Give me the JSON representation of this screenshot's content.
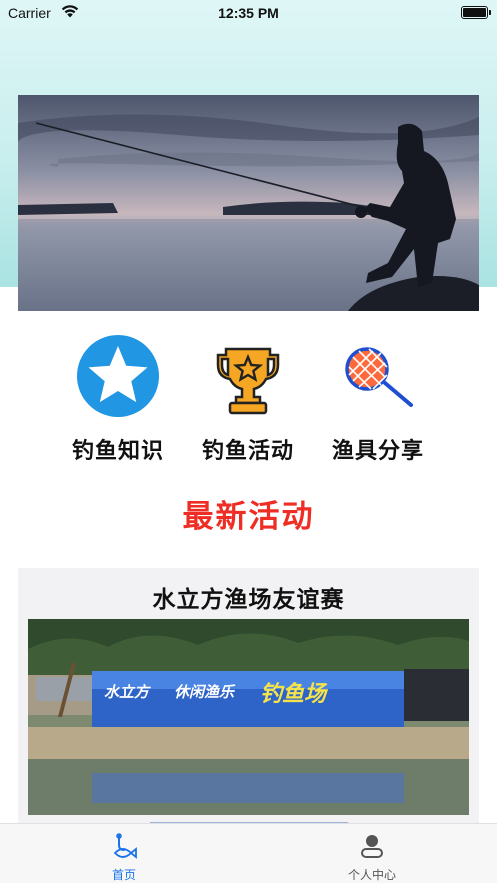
{
  "status_bar": {
    "carrier": "Carrier",
    "time": "12:35 PM"
  },
  "banner": {
    "icon": "fishing-silhouette-photo"
  },
  "menu": {
    "items": [
      {
        "label": "钓鱼知识",
        "icon": "star-icon",
        "color": "#2196e3"
      },
      {
        "label": "钓鱼活动",
        "icon": "trophy-icon",
        "color": "#f5a623"
      },
      {
        "label": "渔具分享",
        "icon": "fishing-net-icon",
        "color": "#ff6a3d"
      }
    ]
  },
  "section": {
    "title": "最新活动",
    "title_color": "#ee2e24"
  },
  "activity": {
    "title": "水立方渔场友谊赛",
    "sign_text_left": "水立方",
    "sign_text_mid": "休闲渔乐",
    "sign_text_right": "钓鱼场"
  },
  "tabbar": {
    "items": [
      {
        "label": "首页",
        "icon": "fish-hook-icon",
        "active": true
      },
      {
        "label": "个人中心",
        "icon": "user-icon",
        "active": false
      }
    ],
    "active_color": "#1a73e8"
  }
}
